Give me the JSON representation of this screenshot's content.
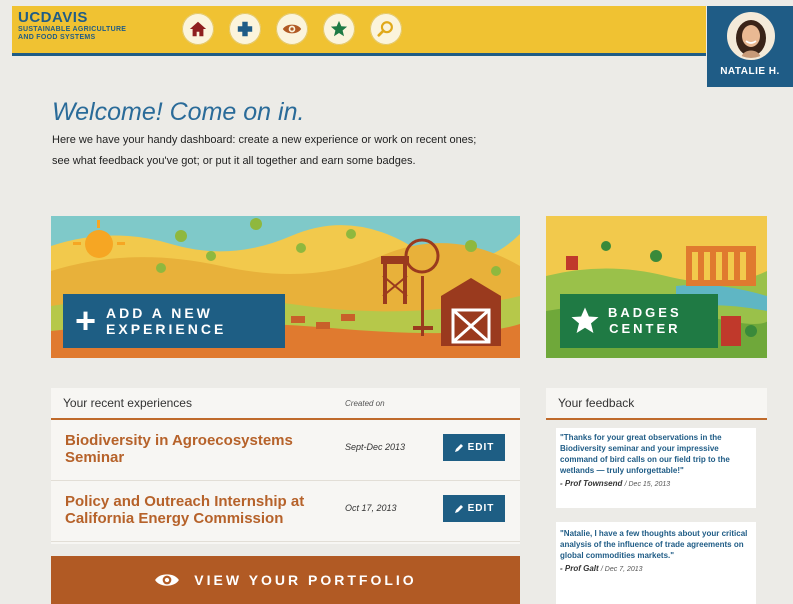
{
  "header": {
    "logo_main": "UCDAVIS",
    "logo_line1": "SUSTAINABLE AGRICULTURE",
    "logo_line2": "AND FOOD SYSTEMS",
    "nav": [
      {
        "icon": "home-icon",
        "color": "#8e1f1f"
      },
      {
        "icon": "plus-icon",
        "color": "#1f5c86"
      },
      {
        "icon": "eye-icon",
        "color": "#b15a24"
      },
      {
        "icon": "star-icon",
        "color": "#1f7a44"
      },
      {
        "icon": "search-icon",
        "color": "#e0a91a"
      }
    ],
    "user_name": "NATALIE H."
  },
  "welcome": {
    "title": "Welcome! Come on in.",
    "intro": "Here we have your handy dashboard: create a new experience or work on recent ones; see what feedback you've got; or put it all together and earn some badges."
  },
  "banners": {
    "add_line1": "ADD A NEW",
    "add_line2": "EXPERIENCE",
    "badges_line1": "BADGES",
    "badges_line2": "CENTER"
  },
  "recent": {
    "title": "Your recent experiences",
    "col_created": "Created on",
    "edit_label": "EDIT",
    "items": [
      {
        "title": "Biodiversity in Agroecosystems Seminar",
        "date": "Sept-Dec 2013"
      },
      {
        "title": "Policy and Outreach Internship at California Energy Commission",
        "date": "Oct 17, 2013"
      }
    ],
    "portfolio_label": "VIEW YOUR PORTFOLIO"
  },
  "feedback": {
    "title": "Your feedback",
    "items": [
      {
        "quote": "\"Thanks for your great observations in the Biodiversity seminar and your impressive command of bird calls on our field trip to the wetlands — truly unforgettable!\"",
        "author": "- Prof Townsend",
        "date": "Dec 15, 2013"
      },
      {
        "quote": "\"Natalie, I have a few thoughts about your critical analysis of the influence of trade agreements on global commodities markets.\"",
        "author": "- Prof Galt",
        "date": "Dec 7, 2013"
      }
    ]
  },
  "colors": {
    "brand_blue": "#1f5c86",
    "brand_yellow": "#f0c232",
    "accent_orange": "#b15a24",
    "badge_green": "#1f7a44"
  }
}
